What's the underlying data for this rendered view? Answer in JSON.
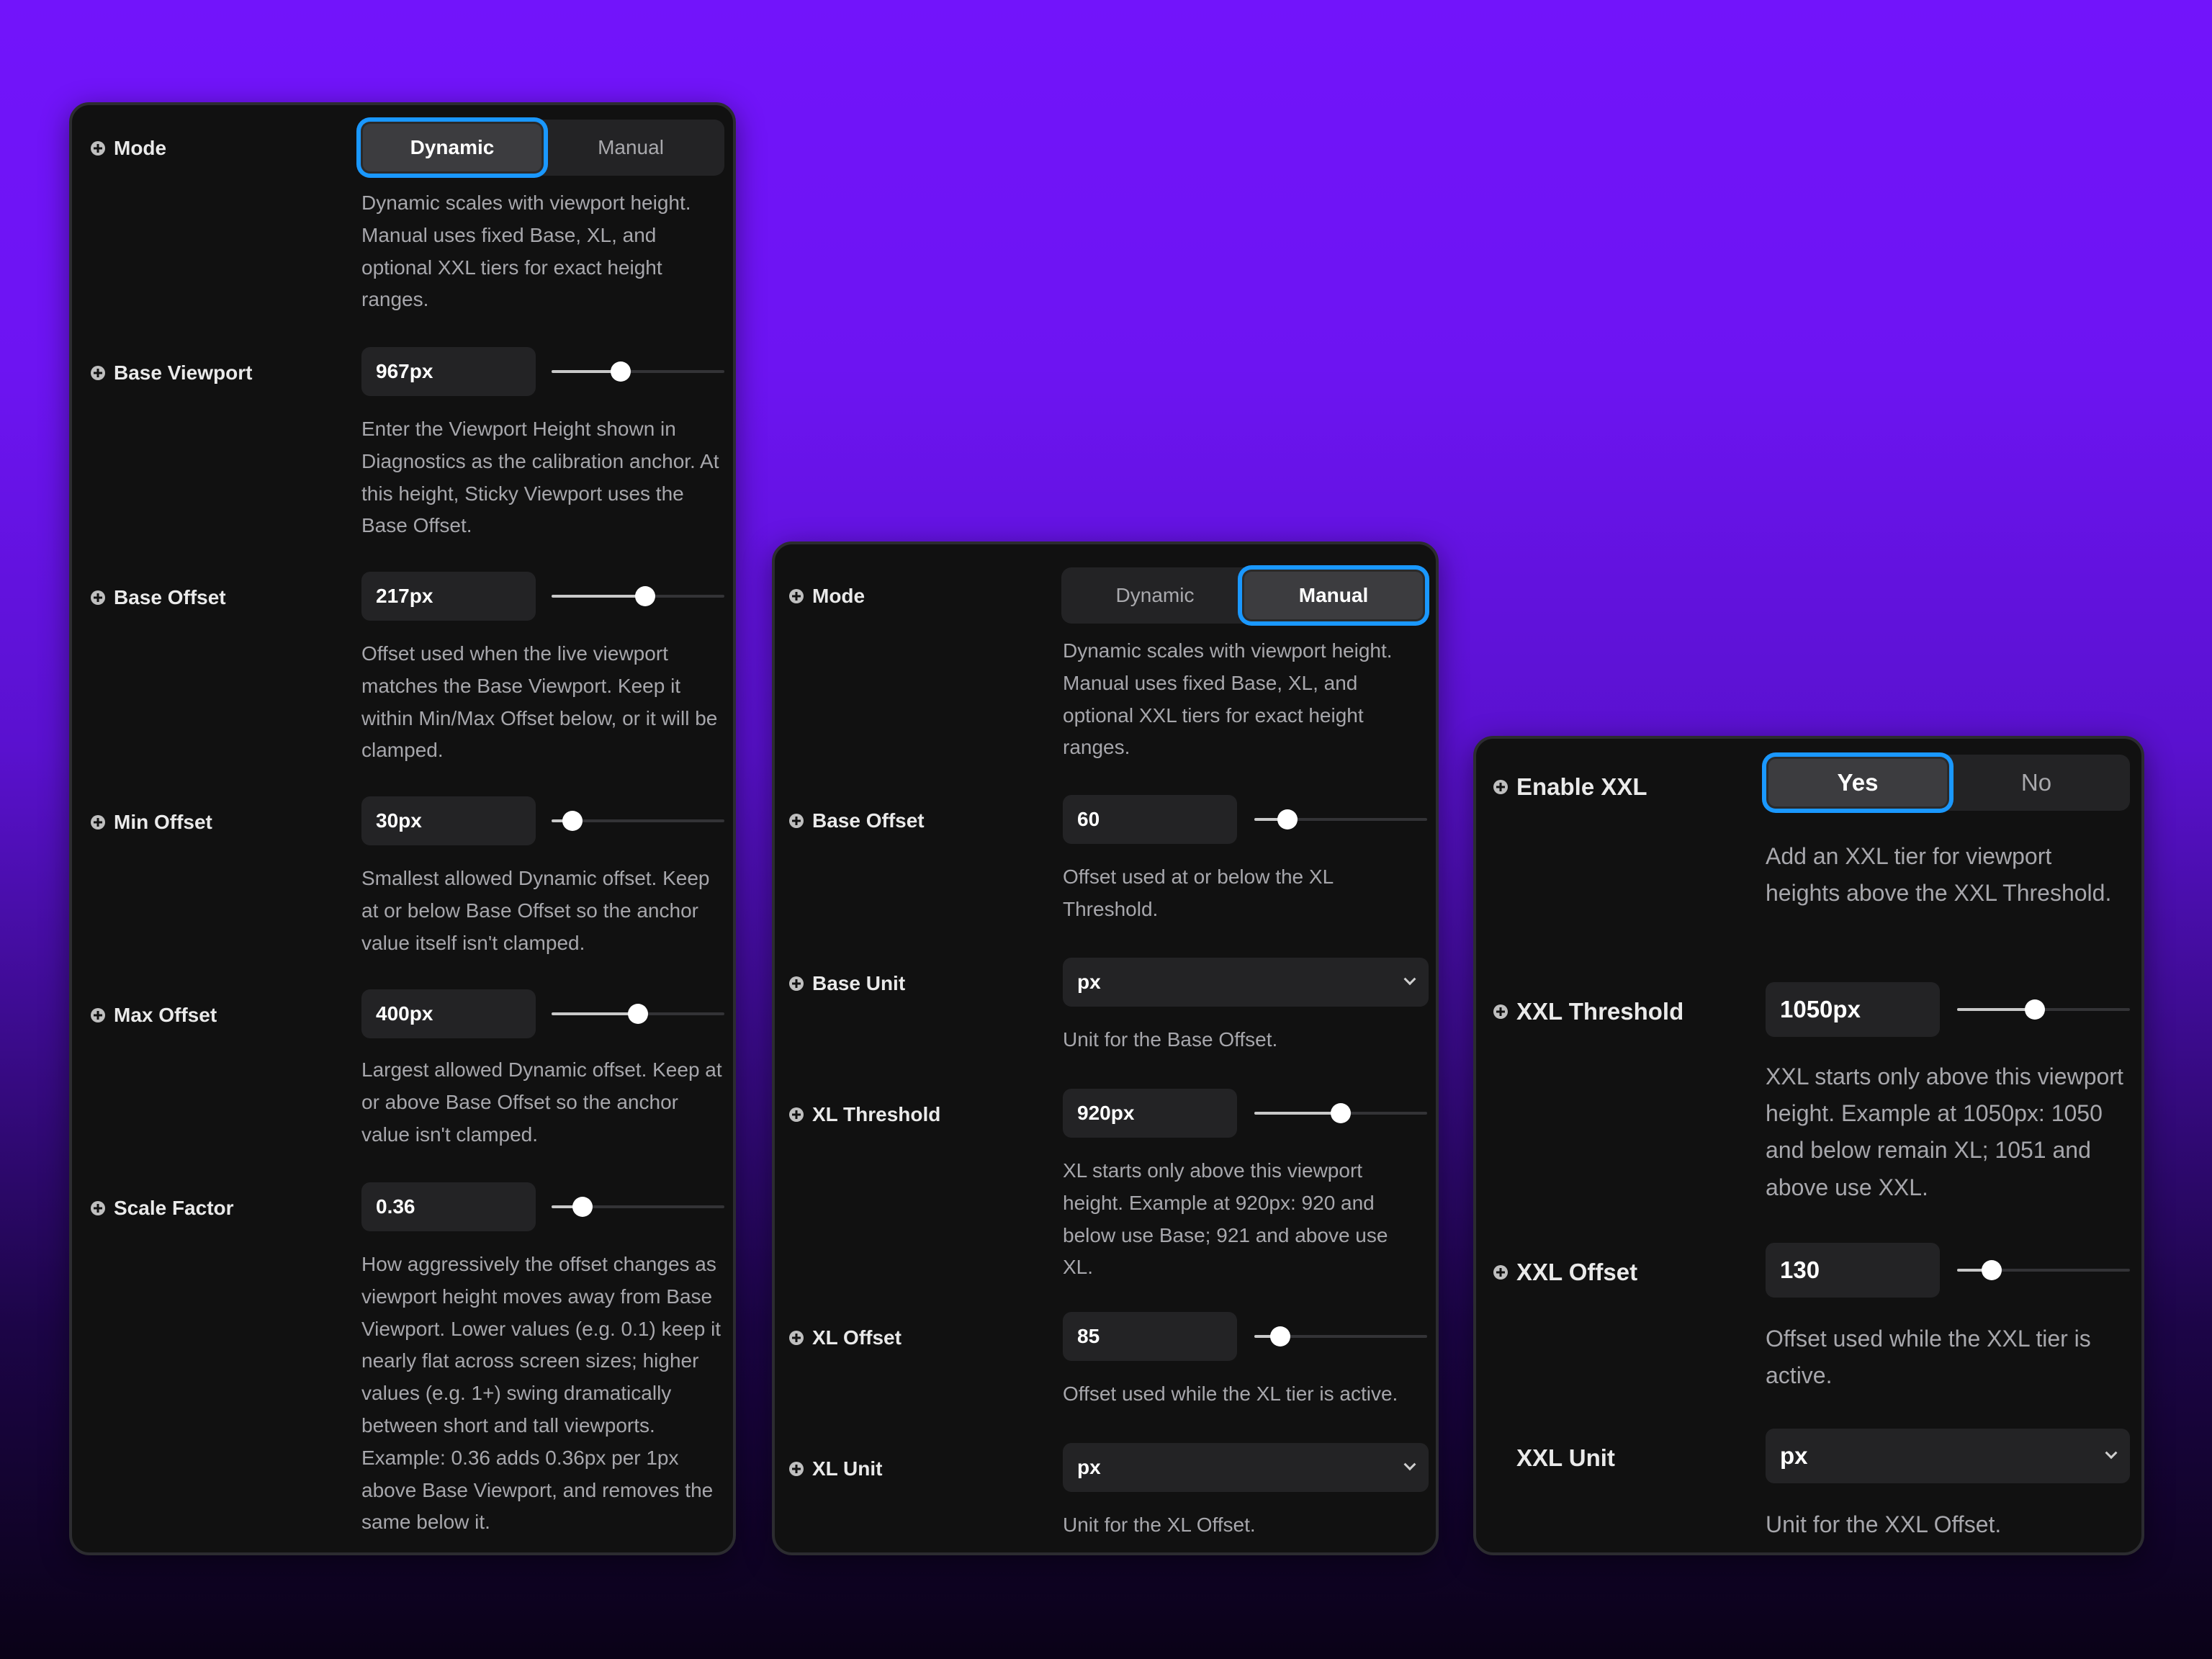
{
  "panels": [
    {
      "mode": {
        "label": "Mode",
        "options": [
          "Dynamic",
          "Manual"
        ],
        "selected": "Dynamic",
        "description": "Dynamic scales with viewport height. Manual uses fixed Base, XL, and optional XXL tiers for exact height ranges."
      },
      "base_viewport": {
        "label": "Base Viewport",
        "value": "967px",
        "slider_fraction": 0.4,
        "description": "Enter the Viewport Height shown in Diagnostics as the calibration anchor. At this height, Sticky Viewport uses the Base Offset."
      },
      "base_offset": {
        "label": "Base Offset",
        "value": "217px",
        "slider_fraction": 0.54,
        "description": "Offset used when the live viewport matches the Base Viewport. Keep it within Min/Max Offset below, or it will be clamped."
      },
      "min_offset": {
        "label": "Min Offset",
        "value": "30px",
        "slider_fraction": 0.12,
        "description": "Smallest allowed Dynamic offset. Keep at or below Base Offset so the anchor value itself isn't clamped."
      },
      "max_offset": {
        "label": "Max Offset",
        "value": "400px",
        "slider_fraction": 0.5,
        "description": "Largest allowed Dynamic offset. Keep at or above Base Offset so the anchor value isn't clamped."
      },
      "scale_factor": {
        "label": "Scale Factor",
        "value": "0.36",
        "slider_fraction": 0.18,
        "description": "How aggressively the offset changes as viewport height moves away from Base Viewport. Lower values (e.g. 0.1) keep it nearly flat across screen sizes; higher values (e.g. 1+) swing dramatically between short and tall viewports. Example: 0.36 adds 0.36px per 1px above Base Viewport, and removes the same below it."
      }
    },
    {
      "mode": {
        "label": "Mode",
        "options": [
          "Dynamic",
          "Manual"
        ],
        "selected": "Manual",
        "description": "Dynamic scales with viewport height. Manual uses fixed Base, XL, and optional XXL tiers for exact height ranges."
      },
      "base_offset": {
        "label": "Base Offset",
        "value": "60",
        "slider_fraction": 0.19,
        "description": "Offset used at or below the XL Threshold."
      },
      "base_unit": {
        "label": "Base Unit",
        "value": "px",
        "description": "Unit for the Base Offset."
      },
      "xl_threshold": {
        "label": "XL Threshold",
        "value": "920px",
        "slider_fraction": 0.5,
        "description": "XL starts only above this viewport height. Example at 920px: 920 and below use Base; 921 and above use XL."
      },
      "xl_offset": {
        "label": "XL Offset",
        "value": "85",
        "slider_fraction": 0.15,
        "description": "Offset used while the XL tier is active."
      },
      "xl_unit": {
        "label": "XL Unit",
        "value": "px",
        "description": "Unit for the XL Offset."
      }
    },
    {
      "enable_xxl": {
        "label": "Enable XXL",
        "options": [
          "Yes",
          "No"
        ],
        "selected": "Yes",
        "description": "Add an XXL tier for viewport heights above the XXL Threshold."
      },
      "xxl_threshold": {
        "label": "XXL Threshold",
        "value": "1050px",
        "slider_fraction": 0.45,
        "description": "XXL starts only above this viewport height. Example at 1050px: 1050 and below remain XL; 1051 and above use XXL."
      },
      "xxl_offset": {
        "label": "XXL Offset",
        "value": "130",
        "slider_fraction": 0.2,
        "description": "Offset used while the XXL tier is active."
      },
      "xxl_unit": {
        "label": "XXL Unit",
        "value": "px",
        "description": "Unit for the XXL Offset."
      }
    }
  ],
  "colors": {
    "background_top": "#7214fb",
    "background_bottom": "#0a0217",
    "panel": "#111111",
    "field": "#232325",
    "focus_ring": "#1a98ff"
  }
}
